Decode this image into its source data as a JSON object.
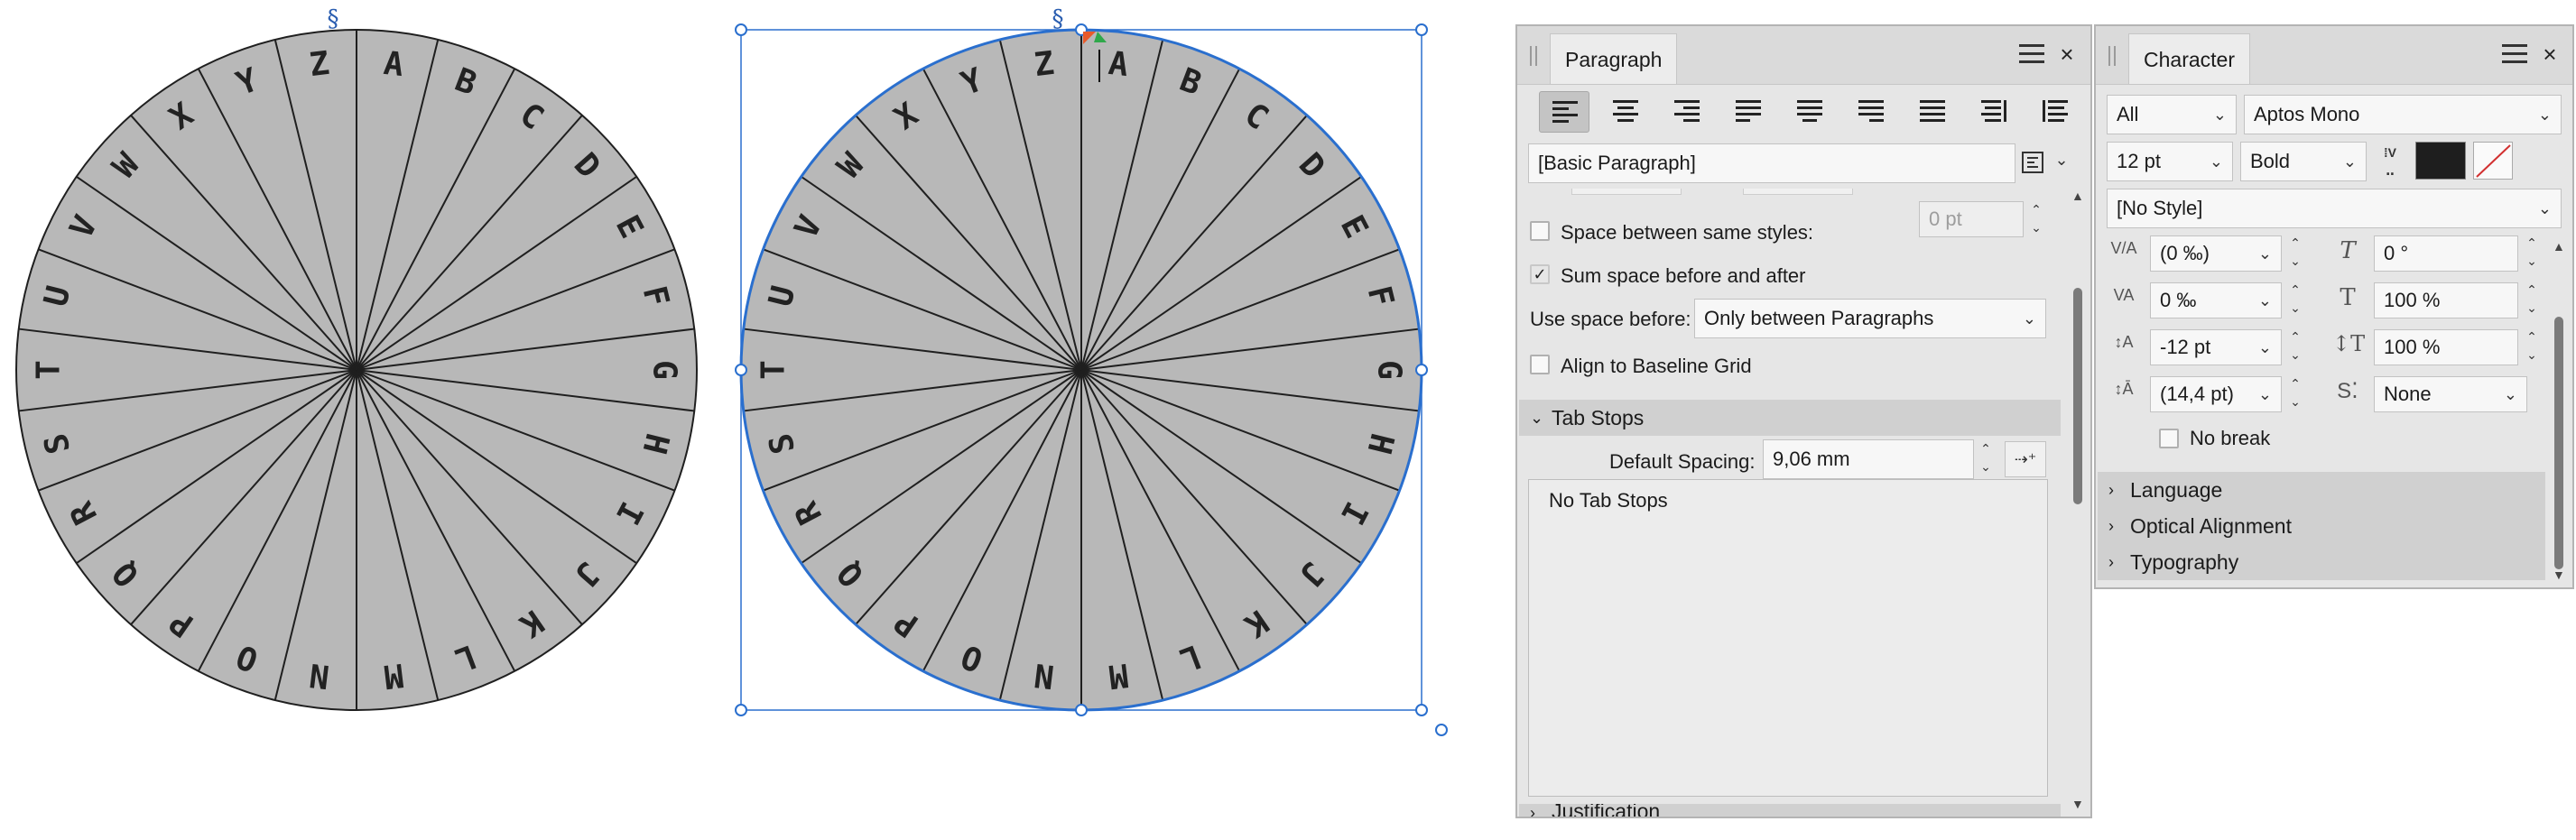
{
  "canvas": {
    "wheel_letters": [
      "A",
      "B",
      "C",
      "D",
      "E",
      "F",
      "G",
      "H",
      "I",
      "J",
      "K",
      "L",
      "M",
      "N",
      "O",
      "P",
      "Q",
      "R",
      "S",
      "T",
      "U",
      "V",
      "W",
      "X",
      "Y",
      "Z"
    ],
    "paragraph_mark": "§",
    "colors": {
      "wheel_fill": "#b8b8b8",
      "stroke": "#1f1f1f",
      "selection": "#2a6fce"
    }
  },
  "paragraph_panel": {
    "title": "Paragraph",
    "style_value": "[Basic Paragraph]",
    "space_between_label": "Space between same styles:",
    "space_between_value": "0 pt",
    "sum_space_label": "Sum space before and after",
    "sum_space_check": "✓",
    "use_space_before_label": "Use space before:",
    "use_space_before_value": "Only between Paragraphs",
    "baseline_label": "Align to Baseline Grid",
    "tab_stops_header": "Tab Stops",
    "default_spacing_label": "Default Spacing:",
    "default_spacing_value": "9,06 mm",
    "no_tab_stops": "No Tab Stops",
    "next_section_partial": "Justification"
  },
  "character_panel": {
    "title": "Character",
    "scope_value": "All",
    "font_value": "Aptos Mono",
    "size_value": "12 pt",
    "weight_value": "Bold",
    "style_value": "[No Style]",
    "kerning_value": "(0 ‰)",
    "italic_angle_value": "0 °",
    "tracking_value": "0 ‰",
    "horiz_scale_value": "100 %",
    "baseline_shift_value": "-12 pt",
    "vert_scale_value": "100 %",
    "leading_value": "(14,4 pt)",
    "typeface_value": "None",
    "no_break_label": "No break",
    "sections": [
      "Language",
      "Optical Alignment",
      "Typography"
    ]
  }
}
